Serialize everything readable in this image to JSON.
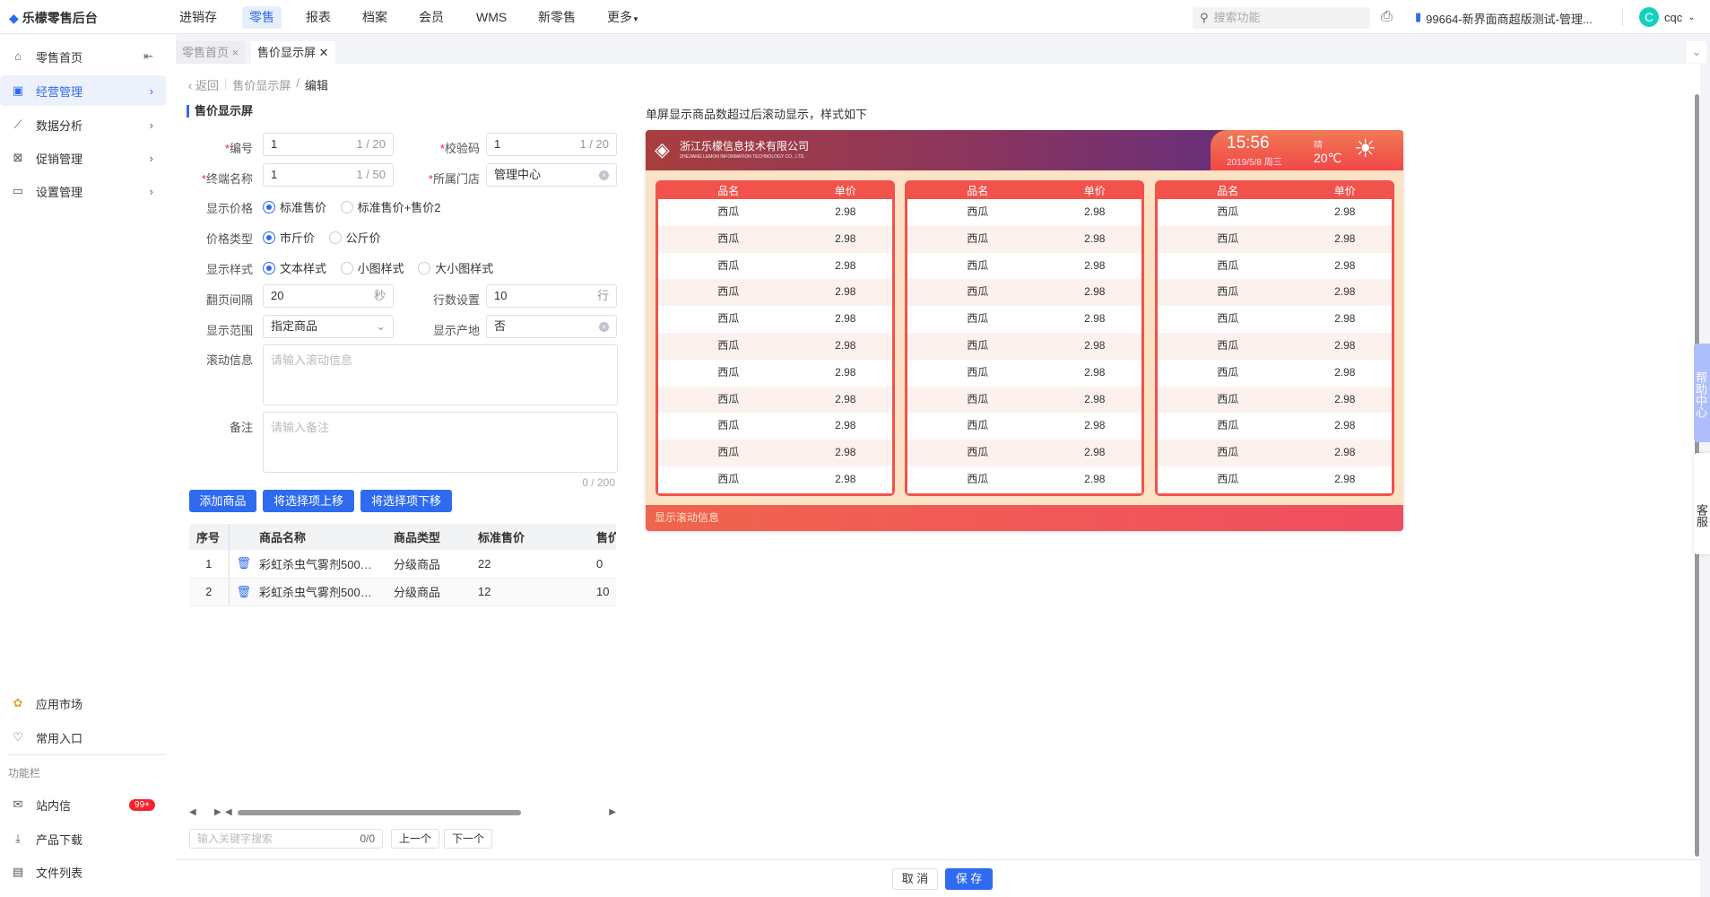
{
  "app": {
    "name": "乐檬零售后台"
  },
  "topnav": [
    "进销存",
    "零售",
    "报表",
    "档案",
    "会员",
    "WMS",
    "新零售",
    "更多"
  ],
  "search_placeholder": "搜索功能",
  "store": "99664-新界面商超版测试-管理...",
  "user": {
    "initial": "C",
    "name": "cqc"
  },
  "sidebar": {
    "items": [
      "零售首页",
      "经营管理",
      "数据分析",
      "促销管理",
      "设置管理"
    ],
    "bottom": [
      "应用市场",
      "常用入口"
    ],
    "section": "功能栏",
    "tools": [
      "站内信",
      "产品下载",
      "文件列表"
    ],
    "badge": "99+"
  },
  "tabs": [
    "零售首页",
    "售价显示屏"
  ],
  "breadcrumb": {
    "back": "返回",
    "parent": "售价显示屏",
    "sep": "/",
    "current": "编辑"
  },
  "section_title": "售价显示屏",
  "form": {
    "code": {
      "label": "编号",
      "value": "1",
      "count": "1 / 20"
    },
    "check": {
      "label": "校验码",
      "value": "1",
      "count": "1 / 20"
    },
    "terminal": {
      "label": "终端名称",
      "value": "1",
      "count": "1 / 50"
    },
    "store": {
      "label": "所属门店",
      "value": "管理中心"
    },
    "show_price": {
      "label": "显示价格",
      "options": [
        "标准售价",
        "标准售价+售价2"
      ]
    },
    "price_type": {
      "label": "价格类型",
      "options": [
        "市斤价",
        "公斤价"
      ]
    },
    "style": {
      "label": "显示样式",
      "options": [
        "文本样式",
        "小图样式",
        "大小图样式"
      ]
    },
    "interval": {
      "label": "翻页间隔",
      "value": "20",
      "unit": "秒"
    },
    "rows": {
      "label": "行数设置",
      "value": "10",
      "unit": "行"
    },
    "range": {
      "label": "显示范围",
      "value": "指定商品"
    },
    "origin": {
      "label": "显示产地",
      "value": "否"
    },
    "scroll": {
      "label": "滚动信息",
      "placeholder": "请输入滚动信息"
    },
    "remark": {
      "label": "备注",
      "placeholder": "请输入备注",
      "count": "0 / 200"
    }
  },
  "buttons": {
    "add": "添加商品",
    "up": "将选择项上移",
    "down": "将选择项下移",
    "cancel": "取 消",
    "save": "保 存",
    "prev": "上一个",
    "next": "下一个"
  },
  "table": {
    "headers": [
      "序号",
      "商品名称",
      "商品类型",
      "标准售价",
      "售价"
    ],
    "rows": [
      [
        "1",
        "彩虹杀虫气雾剂500…",
        "分级商品",
        "22",
        "0"
      ],
      [
        "2",
        "彩虹杀虫气雾剂500…",
        "分级商品",
        "12",
        "10"
      ]
    ]
  },
  "find": {
    "placeholder": "输入关键字搜索",
    "count": "0/0"
  },
  "preview": {
    "caption": "单屏显示商品数超过后滚动显示，样式如下",
    "company": "浙江乐檬信息技术有限公司",
    "company_en": "ZHEJIANG LEMON INFORMATION TECHNOLOGY CO., LTD.",
    "time": "15:56",
    "date": "2019/5/8",
    "weekday": "周三",
    "weather": "晴",
    "temp": "20℃",
    "col_headers": [
      "品名",
      "单价"
    ],
    "items": [
      [
        "西瓜",
        "2.98"
      ],
      [
        "西瓜",
        "2.98"
      ],
      [
        "西瓜",
        "2.98"
      ],
      [
        "西瓜",
        "2.98"
      ],
      [
        "西瓜",
        "2.98"
      ],
      [
        "西瓜",
        "2.98"
      ],
      [
        "西瓜",
        "2.98"
      ],
      [
        "西瓜",
        "2.98"
      ],
      [
        "西瓜",
        "2.98"
      ],
      [
        "西瓜",
        "2.98"
      ],
      [
        "西瓜",
        "2.98"
      ]
    ],
    "footer": "显示滚动信息"
  },
  "float": {
    "help": "帮助中心",
    "service": "客服"
  }
}
